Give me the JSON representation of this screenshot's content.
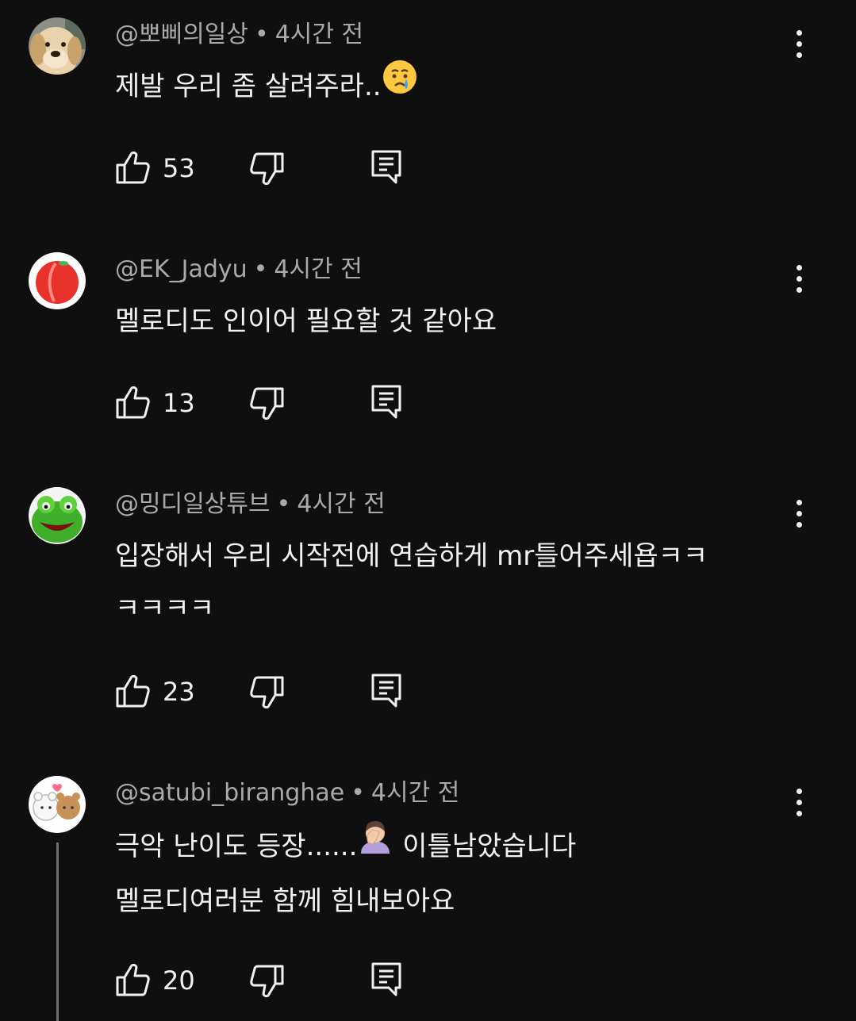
{
  "comments": [
    {
      "avatar": "golden-retriever-avatar",
      "author": "@뽀삐의일상",
      "time": "4시간 전",
      "text_lines": [
        "제발 우리 좀 살려주라.."
      ],
      "emoji": "crying-face-emoji",
      "likes": "53"
    },
    {
      "avatar": "peach-avatar",
      "author": "@EK_Jadyu",
      "time": "4시간 전",
      "text_lines": [
        "멜로디도 인이어 필요할 것 같아요"
      ],
      "likes": "13"
    },
    {
      "avatar": "frog-avatar",
      "author": "@밍디일상튜브",
      "time": "4시간 전",
      "text_lines": [
        "입장해서 우리 시작전에 연습하게 mr틀어주세욥ㅋㅋ",
        "ㅋㅋㅋㅋ"
      ],
      "likes": "23"
    },
    {
      "avatar": "bears-avatar",
      "author": "@satubi_biranghae",
      "time": "4시간 전",
      "text_lines": [
        "극악 난이도 등장......",
        "멜로디여러분 함께 힘내보아요"
      ],
      "text_line0_suffix": " 이틀남았습니다",
      "emoji": "facepalm-emoji",
      "likes": "20"
    }
  ],
  "separator": "•",
  "colors": {
    "background": "#0f0f0f",
    "text": "#f1f1f1",
    "meta": "#aaaaaa",
    "thread_line": "#717171"
  }
}
